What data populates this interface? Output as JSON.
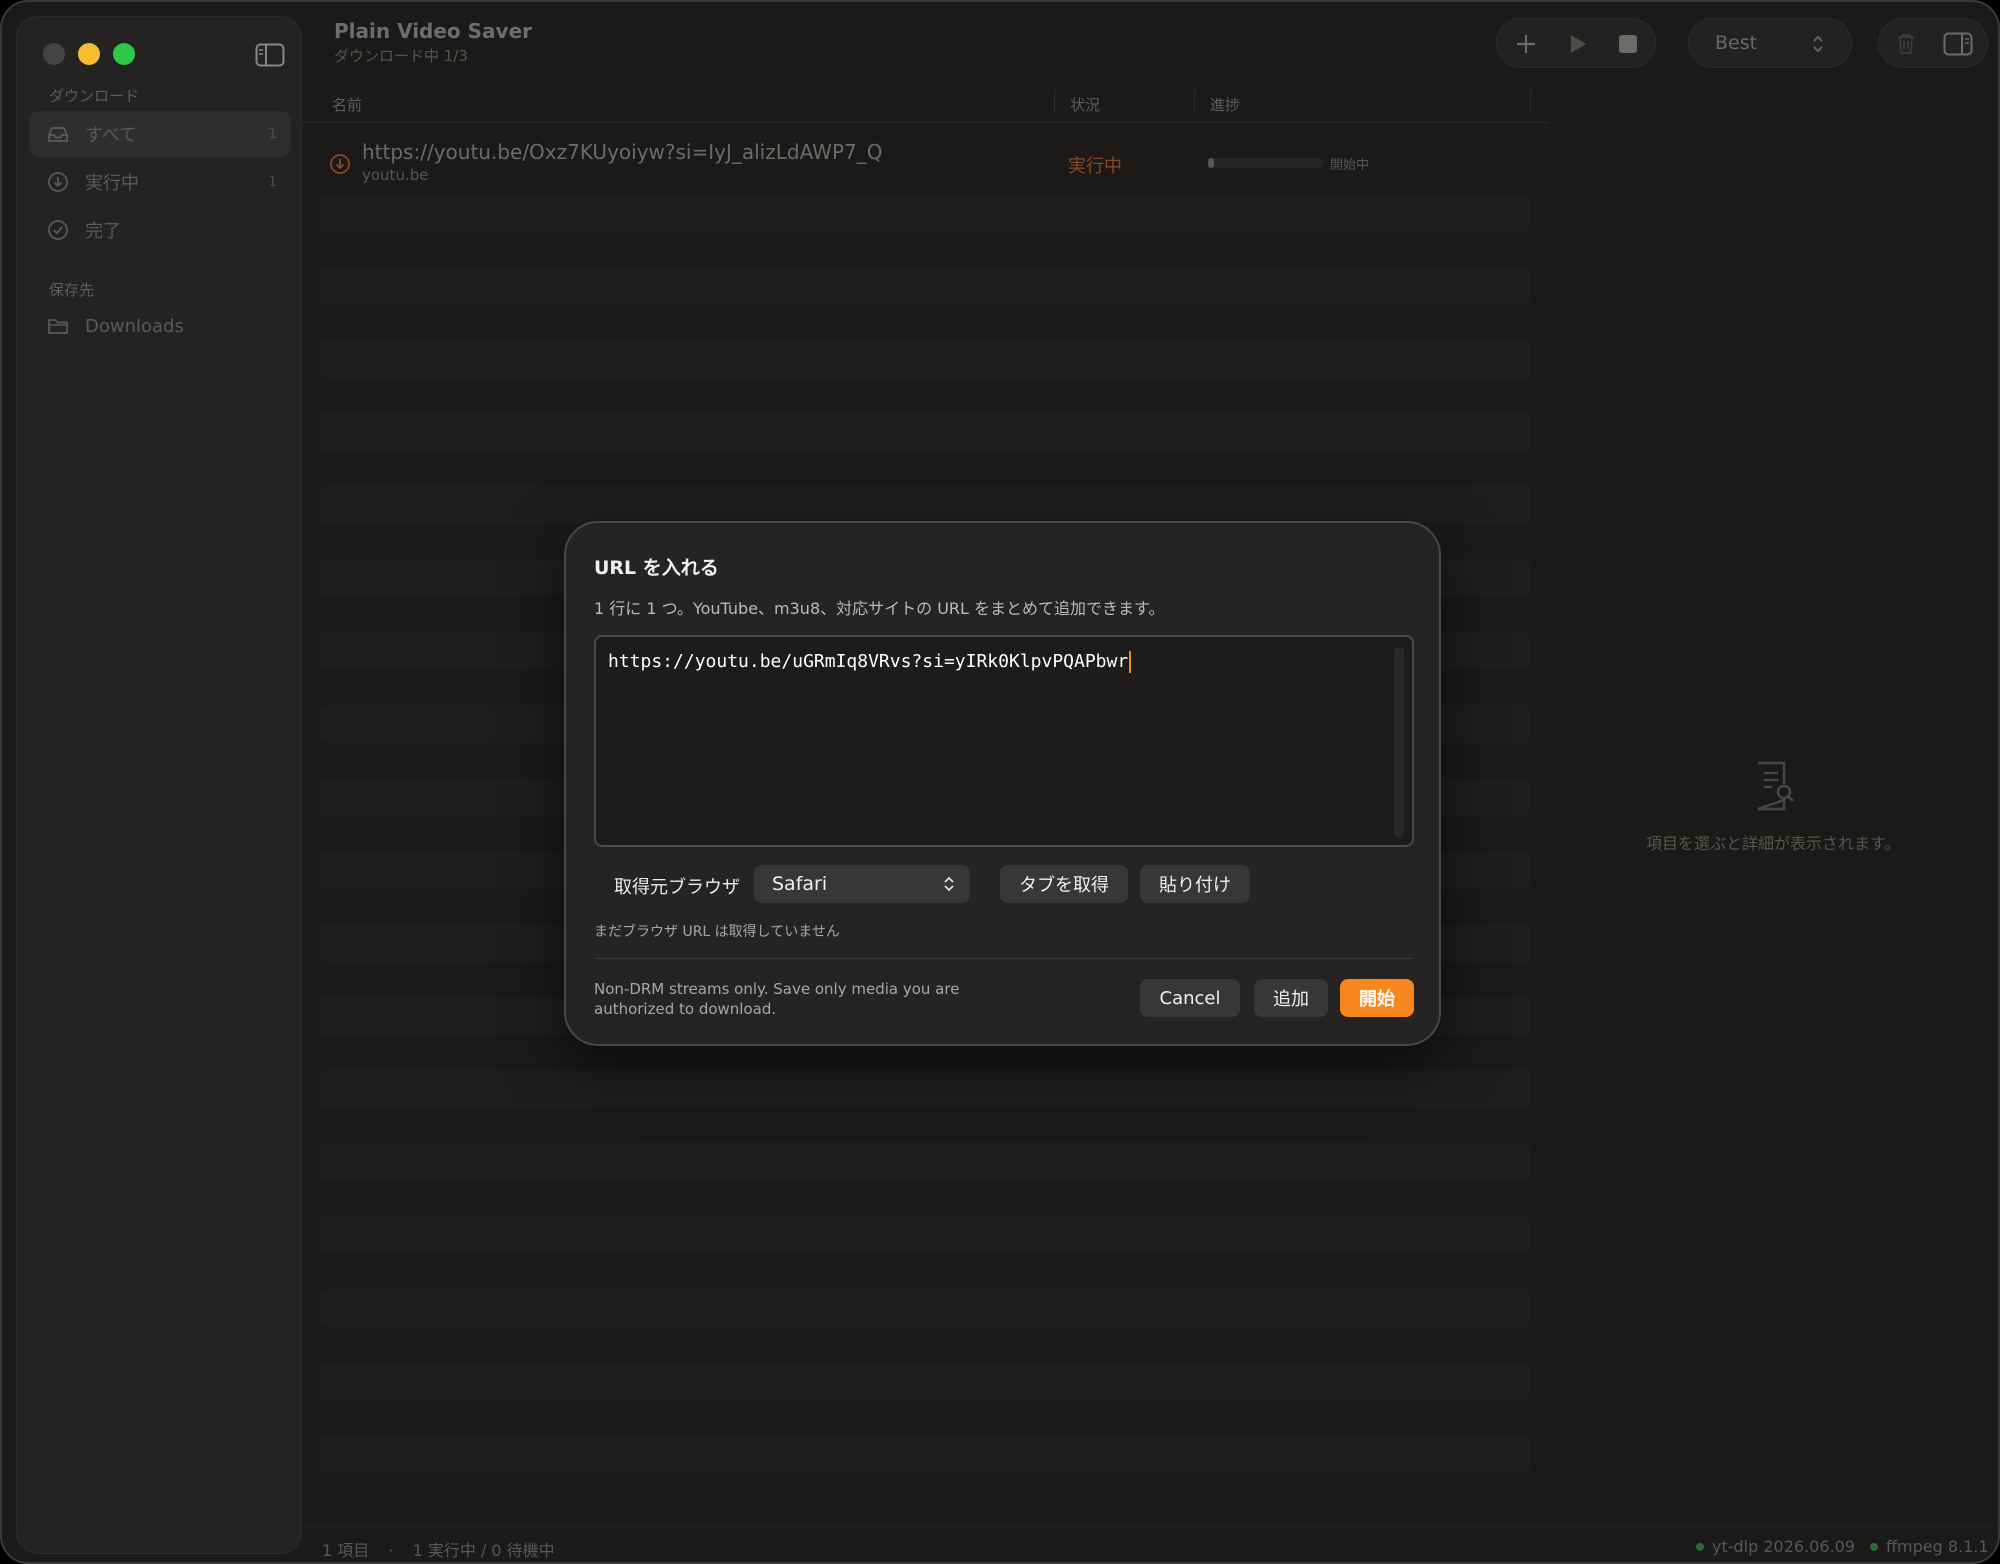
{
  "app": {
    "title": "Plain Video Saver",
    "subtitle": "ダウンロード中 1/3"
  },
  "sidebar": {
    "downloads_header": "ダウンロード",
    "items": [
      {
        "label": "すべて",
        "count": "1",
        "icon": "tray-icon"
      },
      {
        "label": "実行中",
        "count": "1",
        "icon": "download-circle-icon"
      },
      {
        "label": "完了",
        "icon": "checkmark-circle-icon"
      }
    ],
    "destination_header": "保存先",
    "destination": {
      "label": "Downloads",
      "icon": "folder-icon"
    }
  },
  "toolbar": {
    "quality": "Best"
  },
  "table": {
    "columns": [
      "名前",
      "状況",
      "進捗"
    ],
    "rows": [
      {
        "url": "https://youtu.be/Oxz7KUyoiyw?si=IyJ_alizLdAWP7_Q",
        "domain": "youtu.be",
        "status": "実行中",
        "progress_fraction": 0.03,
        "progress_text": "開始中"
      }
    ]
  },
  "detail": {
    "empty_text": "項目を選ぶと詳細が表示されます。"
  },
  "statusbar": {
    "items_count": "1 項目",
    "separator": "·",
    "running_summary": "1 実行中 / 0 待機中",
    "ytdlp": "yt-dlp 2026.06.09",
    "ffmpeg": "ffmpeg 8.1.1"
  },
  "dialog": {
    "title": "URL を入れる",
    "description": "1 行に 1 つ。YouTube、m3u8、対応サイトの URL をまとめて追加できます。",
    "url_input": "https://youtu.be/uGRmIq8VRvs?si=yIRk0KlpvPQAPbwr",
    "browser_label": "取得元ブラウザ",
    "browser_value": "Safari",
    "get_tabs_button": "タブを取得",
    "paste_button": "貼り付け",
    "note": "まだブラウザ URL は取得していません",
    "footer": "Non-DRM streams only. Save only media you are authorized to download.",
    "cancel_button": "Cancel",
    "add_button": "追加",
    "start_button": "開始"
  },
  "colors": {
    "accent": "#f7861f",
    "running": "#8a4a21",
    "dialog_bg": "#262423",
    "window_bg": "#1b1a19"
  }
}
